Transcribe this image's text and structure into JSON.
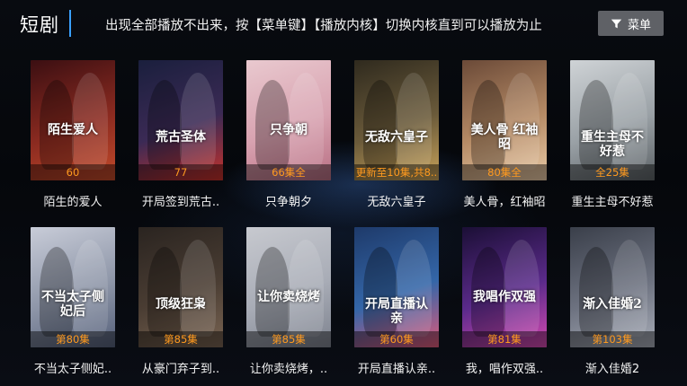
{
  "header": {
    "title": "短剧",
    "notice": "出现全部播放不出来，按【菜单键】【播放内核】切换内核直到可以播放为止",
    "menu_label": "菜单",
    "menu_icon": "filter-icon"
  },
  "colors": {
    "accent": "#3aa0ff",
    "episode_text": "#ff9a1f",
    "menu_button_bg": "#5f6166"
  },
  "dramas": [
    {
      "name": "陌生的爱人",
      "episodes": "60",
      "poster_text": "陌生爱人",
      "palette": [
        "#3b0f12",
        "#8a2a20",
        "#c24a2a"
      ]
    },
    {
      "name": "开局签到荒古..",
      "episodes": "77",
      "poster_text": "荒古圣体",
      "palette": [
        "#1a1f3d",
        "#3b2a55",
        "#c8322a"
      ]
    },
    {
      "name": "只争朝夕",
      "episodes": "66集全",
      "poster_text": "只争朝",
      "palette": [
        "#e9c9cf",
        "#d8a2b0",
        "#b86f83"
      ]
    },
    {
      "name": "无敌六皇子",
      "episodes": "更新至10集,共8..",
      "poster_text": "无敌六皇子",
      "palette": [
        "#2f2a1e",
        "#6a5a3a",
        "#c9a35a"
      ]
    },
    {
      "name": "美人骨，红袖昭",
      "episodes": "80集全",
      "poster_text": "美人骨 红袖昭",
      "palette": [
        "#6b4a38",
        "#b58a65",
        "#e8c9a5"
      ]
    },
    {
      "name": "重生主母不好惹",
      "episodes": "全25集",
      "poster_text": "重生主母不好惹",
      "palette": [
        "#cfd3d6",
        "#9aa1a6",
        "#5c6266"
      ]
    },
    {
      "name": "不当太子侧妃..",
      "episodes": "第80集",
      "poster_text": "不当太子侧妃后",
      "palette": [
        "#c8ccd8",
        "#8e96a8",
        "#55607a"
      ]
    },
    {
      "name": "从豪门弃子到..",
      "episodes": "第85集",
      "poster_text": "顶级狂枭",
      "palette": [
        "#2a2420",
        "#4a3d33",
        "#7a6553"
      ]
    },
    {
      "name": "让你卖烧烤，..",
      "episodes": "第85集",
      "poster_text": "让你卖烧烤",
      "palette": [
        "#c7c9cf",
        "#a8acb6",
        "#7d828e"
      ]
    },
    {
      "name": "开局直播认亲..",
      "episodes": "第60集",
      "poster_text": "开局直播认亲",
      "palette": [
        "#1e3a6a",
        "#3466a8",
        "#e05a7a"
      ]
    },
    {
      "name": "我，唱作双强..",
      "episodes": "第81集",
      "poster_text": "我唱作双强",
      "palette": [
        "#1b0f35",
        "#5a2a8a",
        "#d44ab0"
      ]
    },
    {
      "name": "渐入佳婚2",
      "episodes": "第103集",
      "poster_text": "渐入佳婚2",
      "palette": [
        "#3a3f4a",
        "#6d7280",
        "#a8adb8"
      ]
    }
  ]
}
